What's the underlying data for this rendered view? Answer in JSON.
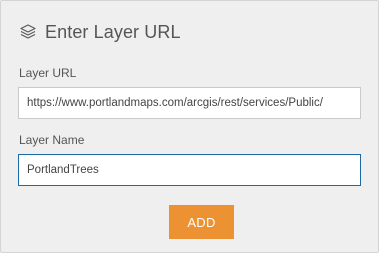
{
  "header": {
    "icon": "layers-icon",
    "title": "Enter Layer URL"
  },
  "layer_url": {
    "label": "Layer URL",
    "value": "https://www.portlandmaps.com/arcgis/rest/services/Public/"
  },
  "layer_name": {
    "label": "Layer Name",
    "value": "PortlandTrees"
  },
  "actions": {
    "add_label": "ADD"
  },
  "colors": {
    "panel_background": "#efefef",
    "add_button": "#ec9233",
    "focused_border": "#1c6aa6"
  }
}
